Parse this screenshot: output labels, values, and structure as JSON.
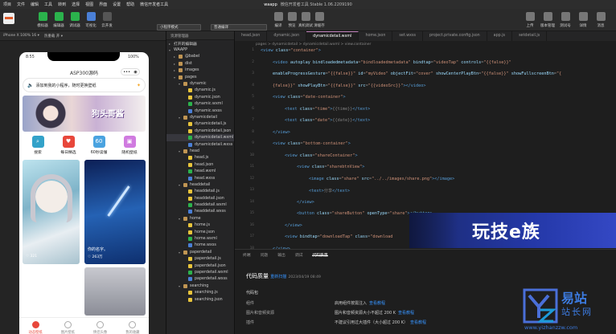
{
  "app": {
    "project": "waapp",
    "title": "微信开发者工具 Stable 1.06.2209190"
  },
  "menu": [
    "项目",
    "文件",
    "编辑",
    "工具",
    "转到",
    "选择",
    "视图",
    "界面",
    "设置",
    "帮助",
    "微信开发者工具"
  ],
  "toolbar": {
    "left": [
      {
        "label": "模拟器",
        "color": "#2bb24c"
      },
      {
        "label": "编辑器",
        "color": "#2bb24c"
      },
      {
        "label": "调试器",
        "color": "#2bb24c"
      },
      {
        "label": "可视化",
        "color": "#4a7fd6"
      },
      {
        "label": "云开发",
        "color": "#555"
      }
    ],
    "mode": "小程序模式",
    "compile": "普通编译",
    "mid": [
      {
        "label": "编译",
        "color": "#777"
      },
      {
        "label": "预览",
        "color": "#777"
      },
      {
        "label": "真机调试",
        "color": "#777"
      },
      {
        "label": "清缓存",
        "color": "#777"
      }
    ],
    "right": [
      {
        "label": "上传",
        "color": "#777"
      },
      {
        "label": "版本管理",
        "color": "#777"
      },
      {
        "label": "测试号",
        "color": "#777"
      },
      {
        "label": "详情",
        "color": "#777"
      },
      {
        "label": "消息",
        "color": "#777"
      }
    ]
  },
  "simulator": {
    "device": "iPhone X 100% 16 ▾",
    "hot": "热重载 开 ▾"
  },
  "phone": {
    "time": "8:55",
    "battery": "100%",
    "title": "ASP300源码",
    "notice": "添加到我的小程序，随时更换壁纸",
    "banner": "狗头哥酱",
    "cats": [
      {
        "label": "搜索",
        "color": "#33a2c9",
        "glyph": "⌕"
      },
      {
        "label": "每日精选",
        "color": "#e8473b",
        "glyph": "♥"
      },
      {
        "label": "60秒读懂",
        "color": "#4aa3e0",
        "glyph": "60"
      },
      {
        "label": "随机壁纸",
        "color": "#d07be0",
        "glyph": "▣"
      }
    ],
    "cards": [
      {
        "caption": "",
        "likes": "321"
      },
      {
        "caption": "你的名字。",
        "likes": "263万"
      }
    ],
    "nav": [
      "动态壁纸",
      "图片壁纸",
      "情侣头像",
      "我的收藏"
    ]
  },
  "explorer": {
    "header": "资源管理器",
    "open": "打开的编辑器",
    "root": "WAAPP",
    "nodes": [
      {
        "d": 1,
        "f": true,
        "n": "@babel"
      },
      {
        "d": 1,
        "f": true,
        "n": "dist"
      },
      {
        "d": 1,
        "f": true,
        "n": "images"
      },
      {
        "d": 1,
        "f": true,
        "n": "pages",
        "o": true
      },
      {
        "d": 2,
        "f": true,
        "n": "dynamic",
        "o": true
      },
      {
        "d": 3,
        "n": "dynamic.js",
        "c": "#e8c43b"
      },
      {
        "d": 3,
        "n": "dynamic.json",
        "c": "#e8c43b"
      },
      {
        "d": 3,
        "n": "dynamic.wxml",
        "c": "#2bb24c"
      },
      {
        "d": 3,
        "n": "dynamic.wxss",
        "c": "#4a7fd6"
      },
      {
        "d": 2,
        "f": true,
        "n": "dynamicdetail",
        "o": true
      },
      {
        "d": 3,
        "n": "dynamicdetail.js",
        "c": "#e8c43b"
      },
      {
        "d": 3,
        "n": "dynamicdetail.json",
        "c": "#e8c43b"
      },
      {
        "d": 3,
        "n": "dynamicdetail.wxml",
        "c": "#2bb24c",
        "s": true
      },
      {
        "d": 3,
        "n": "dynamicdetail.wxss",
        "c": "#4a7fd6"
      },
      {
        "d": 2,
        "f": true,
        "n": "head",
        "o": true
      },
      {
        "d": 3,
        "n": "head.js",
        "c": "#e8c43b"
      },
      {
        "d": 3,
        "n": "head.json",
        "c": "#e8c43b"
      },
      {
        "d": 3,
        "n": "head.wxml",
        "c": "#2bb24c"
      },
      {
        "d": 3,
        "n": "head.wxss",
        "c": "#4a7fd6"
      },
      {
        "d": 2,
        "f": true,
        "n": "headdetail",
        "o": true
      },
      {
        "d": 3,
        "n": "headdetail.js",
        "c": "#e8c43b"
      },
      {
        "d": 3,
        "n": "headdetail.json",
        "c": "#e8c43b"
      },
      {
        "d": 3,
        "n": "headdetail.wxml",
        "c": "#2bb24c"
      },
      {
        "d": 3,
        "n": "headdetail.wxss",
        "c": "#4a7fd6"
      },
      {
        "d": 2,
        "f": true,
        "n": "home",
        "o": true
      },
      {
        "d": 3,
        "n": "home.js",
        "c": "#e8c43b"
      },
      {
        "d": 3,
        "n": "home.json",
        "c": "#e8c43b"
      },
      {
        "d": 3,
        "n": "home.wxml",
        "c": "#2bb24c"
      },
      {
        "d": 3,
        "n": "home.wxss",
        "c": "#4a7fd6"
      },
      {
        "d": 2,
        "f": true,
        "n": "paperdetail",
        "o": true
      },
      {
        "d": 3,
        "n": "paperdetail.js",
        "c": "#e8c43b"
      },
      {
        "d": 3,
        "n": "paperdetail.json",
        "c": "#e8c43b"
      },
      {
        "d": 3,
        "n": "paperdetail.wxml",
        "c": "#2bb24c"
      },
      {
        "d": 3,
        "n": "paperdetail.wxss",
        "c": "#4a7fd6"
      },
      {
        "d": 2,
        "f": true,
        "n": "searching",
        "o": true
      },
      {
        "d": 3,
        "n": "searching.js",
        "c": "#e8c43b"
      },
      {
        "d": 3,
        "n": "searching.json",
        "c": "#e8c43b"
      }
    ]
  },
  "tabs": [
    "head.json",
    "dynamic.json",
    "dynamicdetail.wxml",
    "home.json",
    "set.wxss",
    "project.private.config.json",
    "app.js",
    "setdetail.js"
  ],
  "active_tab": 2,
  "breadcrumb": "pages > dynamicdetail > dynamicdetail.wxml > view.container",
  "code": [
    {
      "t": [
        [
          "tg",
          "<view "
        ],
        [
          "at",
          "class"
        ],
        [
          "pu",
          "="
        ],
        [
          "st",
          "\"container\""
        ],
        [
          "tg",
          ">"
        ]
      ]
    },
    {
      "i": 1,
      "t": [
        [
          "tg",
          "<video "
        ],
        [
          "at",
          "autoplay bindloadedmetadata"
        ],
        [
          "pu",
          "="
        ],
        [
          "st",
          "\"bindloadedmetadata\""
        ],
        [
          "at",
          " bindtap"
        ],
        [
          "pu",
          "="
        ],
        [
          "st",
          "\"videoTap\""
        ],
        [
          "at",
          " controls"
        ],
        [
          "pu",
          "="
        ],
        [
          "st",
          "\"{{false}}\""
        ]
      ]
    },
    {
      "i": 1,
      "t": [
        [
          "at",
          "enableProgressGesture"
        ],
        [
          "pu",
          "="
        ],
        [
          "st",
          "\"{{false}}\""
        ],
        [
          "at",
          " id"
        ],
        [
          "pu",
          "="
        ],
        [
          "st",
          "\"myVideo\""
        ],
        [
          "at",
          " objectFit"
        ],
        [
          "pu",
          "="
        ],
        [
          "st",
          "\"cover\""
        ],
        [
          "at",
          " showCenterPlayBtn"
        ],
        [
          "pu",
          "="
        ],
        [
          "st",
          "\"{{false}}\""
        ],
        [
          "at",
          " showFullscreenBtn"
        ],
        [
          "pu",
          "="
        ],
        [
          "st",
          "\"{"
        ]
      ]
    },
    {
      "i": 1,
      "t": [
        [
          "st",
          "{false}}\""
        ],
        [
          "at",
          " showPlayBtn"
        ],
        [
          "pu",
          "="
        ],
        [
          "st",
          "\"{{false}}\""
        ],
        [
          "at",
          " src"
        ],
        [
          "pu",
          "="
        ],
        [
          "st",
          "\"{{videoSrc}}\""
        ],
        [
          "tg",
          "></video>"
        ]
      ]
    },
    {
      "i": 1,
      "t": [
        [
          "tg",
          "<view "
        ],
        [
          "at",
          "class"
        ],
        [
          "pu",
          "="
        ],
        [
          "st",
          "\"date-container\""
        ],
        [
          "tg",
          ">"
        ]
      ]
    },
    {
      "i": 2,
      "t": [
        [
          "tg",
          "<text "
        ],
        [
          "at",
          "class"
        ],
        [
          "pu",
          "="
        ],
        [
          "st",
          "\"time\""
        ],
        [
          "tg",
          ">"
        ],
        [
          "pu",
          "{{time}}"
        ],
        [
          "tg",
          "</text>"
        ]
      ]
    },
    {
      "i": 2,
      "t": [
        [
          "tg",
          "<text "
        ],
        [
          "at",
          "class"
        ],
        [
          "pu",
          "="
        ],
        [
          "st",
          "\"date\""
        ],
        [
          "tg",
          ">"
        ],
        [
          "pu",
          "{{date}}"
        ],
        [
          "tg",
          "</text>"
        ]
      ]
    },
    {
      "i": 1,
      "t": [
        [
          "tg",
          "</view>"
        ]
      ]
    },
    {
      "i": 1,
      "t": [
        [
          "tg",
          "<view "
        ],
        [
          "at",
          "class"
        ],
        [
          "pu",
          "="
        ],
        [
          "st",
          "\"bottom-container\""
        ],
        [
          "tg",
          ">"
        ]
      ]
    },
    {
      "i": 2,
      "t": [
        [
          "tg",
          "<view "
        ],
        [
          "at",
          "class"
        ],
        [
          "pu",
          "="
        ],
        [
          "st",
          "\"shareContainer\""
        ],
        [
          "tg",
          ">"
        ]
      ]
    },
    {
      "i": 3,
      "t": [
        [
          "tg",
          "<view "
        ],
        [
          "at",
          "class"
        ],
        [
          "pu",
          "="
        ],
        [
          "st",
          "\"sharebtnView\""
        ],
        [
          "tg",
          ">"
        ]
      ]
    },
    {
      "i": 4,
      "t": [
        [
          "tg",
          "<image "
        ],
        [
          "at",
          "class"
        ],
        [
          "pu",
          "="
        ],
        [
          "st",
          "\"share\""
        ],
        [
          "at",
          " src"
        ],
        [
          "pu",
          "="
        ],
        [
          "st",
          "\"../../images/share.png\""
        ],
        [
          "tg",
          "></image>"
        ]
      ]
    },
    {
      "i": 4,
      "t": [
        [
          "tg",
          "<text>"
        ],
        [
          "pu",
          "分享"
        ],
        [
          "tg",
          "</text>"
        ]
      ]
    },
    {
      "i": 3,
      "t": [
        [
          "tg",
          "</view>"
        ]
      ]
    },
    {
      "i": 3,
      "t": [
        [
          "tg",
          "<button "
        ],
        [
          "at",
          "class"
        ],
        [
          "pu",
          "="
        ],
        [
          "st",
          "\"shareButton\""
        ],
        [
          "at",
          " openType"
        ],
        [
          "pu",
          "="
        ],
        [
          "st",
          "\"share\""
        ],
        [
          "tg",
          "></button>"
        ]
      ]
    },
    {
      "i": 2,
      "t": [
        [
          "tg",
          "</view>"
        ]
      ]
    },
    {
      "i": 2,
      "t": [
        [
          "tg",
          "<view "
        ],
        [
          "at",
          "bindtap"
        ],
        [
          "pu",
          "="
        ],
        [
          "st",
          "\"downloadTap\""
        ],
        [
          "at",
          " class"
        ],
        [
          "pu",
          "="
        ],
        [
          "st",
          "\"download"
        ]
      ]
    },
    {
      "i": 1,
      "t": [
        [
          "tg",
          "</view>"
        ]
      ]
    },
    {
      "i": 1,
      "t": [
        [
          "tg",
          "<image "
        ],
        [
          "at",
          "bindtap"
        ],
        [
          "pu",
          "="
        ],
        [
          "st",
          "\"backTap\""
        ],
        [
          "at",
          " class"
        ],
        [
          "pu",
          "="
        ],
        [
          "st",
          "\"home\""
        ],
        [
          "at",
          " src"
        ],
        [
          "pu",
          "="
        ],
        [
          "st",
          "\"..."
        ]
      ]
    }
  ],
  "bottom": {
    "tabs": [
      "终端",
      "问题",
      "输出",
      "调试",
      "代码质量"
    ],
    "active": 4,
    "title": "代码质量",
    "rescan": "重新扫描",
    "time": "2023/04/19 08:49",
    "section": "代码包",
    "rows": [
      {
        "k": "组件",
        "v": "启用组件按需注入",
        "l": "查看教程"
      },
      {
        "k": "图片和音频资源",
        "v": "图片和音频资源大小不超过 200 K",
        "l": "查看教程"
      },
      {
        "k": "插件",
        "v": "不建议引用过大插件（大小超过 200 K）",
        "l": "查看教程"
      }
    ]
  },
  "promo": "玩技e族",
  "watermark": {
    "brand": "易站",
    "sub": "站长网",
    "url": "www.yizhanzzw.com"
  }
}
